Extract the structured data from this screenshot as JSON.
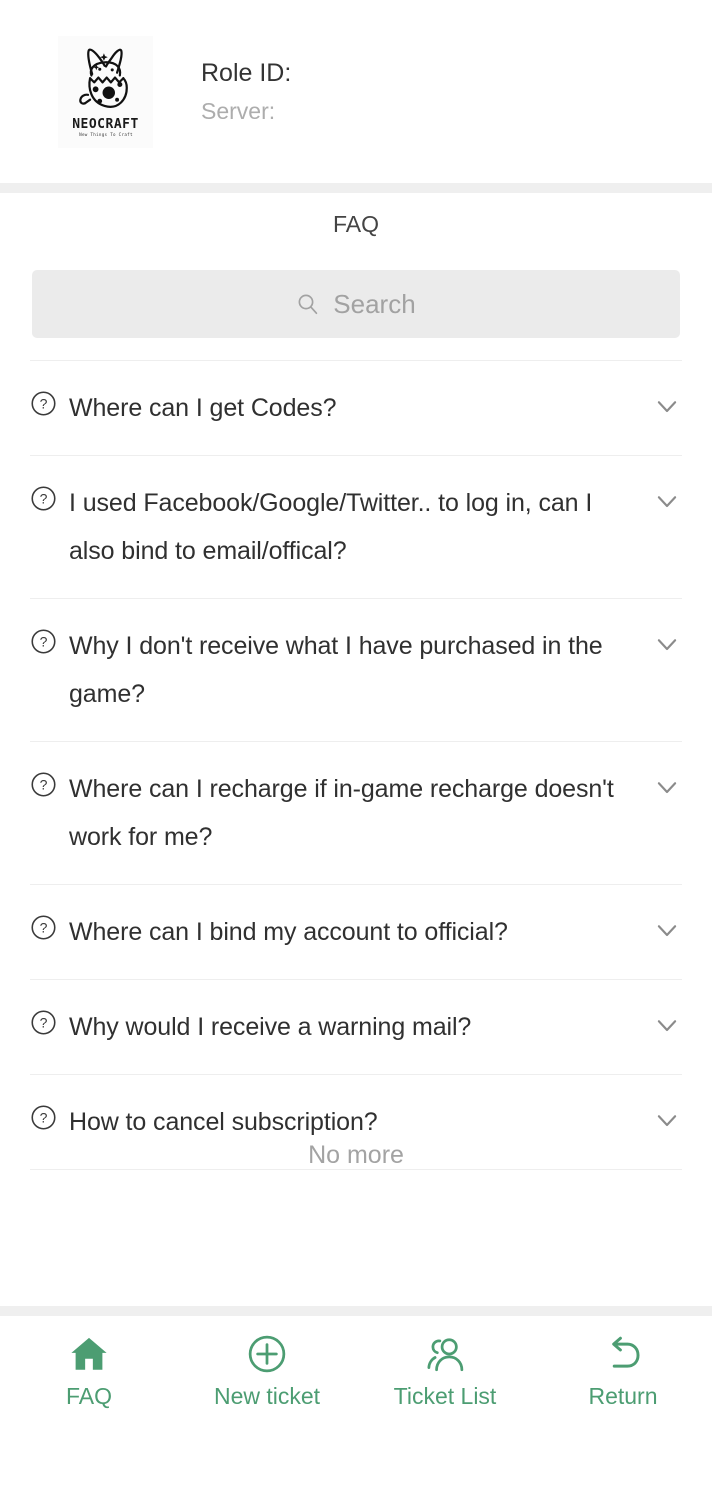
{
  "theme": {
    "accent": "#4c9d72",
    "text_primary": "#303030",
    "text_muted": "#a3a3a3",
    "search_bg": "#ebebeb",
    "separator": "#efefef",
    "edge_handle": "#8d9a8f"
  },
  "header": {
    "logo": {
      "icon": "neocraft-dog-logo",
      "wordmark": "NEOCRAFT",
      "tagline": "New Things To Craft"
    },
    "role_id_label": "Role ID:",
    "server_label": "Server:"
  },
  "page": {
    "title": "FAQ"
  },
  "search": {
    "icon": "search-icon",
    "placeholder": "Search",
    "value": ""
  },
  "faq": {
    "items": [
      {
        "icon": "question-circle-icon",
        "question": "Where can I get Codes?",
        "expand_icon": "chevron-down-icon"
      },
      {
        "icon": "question-circle-icon",
        "question": "I used Facebook/Google/Twitter.. to log in, can I also bind to email/offical?",
        "expand_icon": "chevron-down-icon"
      },
      {
        "icon": "question-circle-icon",
        "question": "Why I don't receive what I have purchased in the game?",
        "expand_icon": "chevron-down-icon"
      },
      {
        "icon": "question-circle-icon",
        "question": "Where can I recharge if in-game recharge doesn't work for me?",
        "expand_icon": "chevron-down-icon"
      },
      {
        "icon": "question-circle-icon",
        "question": "Where can I bind my account to official?",
        "expand_icon": "chevron-down-icon"
      },
      {
        "icon": "question-circle-icon",
        "question": "Why would I receive a warning mail?",
        "expand_icon": "chevron-down-icon"
      },
      {
        "icon": "question-circle-icon",
        "question": "How to cancel subscription?",
        "expand_icon": "chevron-down-icon"
      }
    ],
    "end_of_list_text": "No more"
  },
  "bottom_nav": {
    "items": [
      {
        "icon": "home-icon",
        "label": "FAQ",
        "active": true
      },
      {
        "icon": "plus-circle-icon",
        "label": "New ticket",
        "active": false
      },
      {
        "icon": "users-icon",
        "label": "Ticket List",
        "active": false
      },
      {
        "icon": "undo-arrow-icon",
        "label": "Return",
        "active": false
      }
    ]
  }
}
